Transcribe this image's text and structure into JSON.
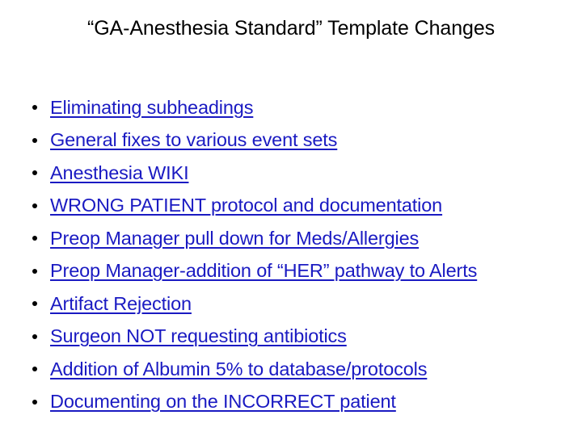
{
  "slide": {
    "title": "“GA-Anesthesia Standard” Template Changes",
    "background_color": "#ffffff",
    "title_color": "#000000",
    "bullet_marker_color": "#000000",
    "link_color": "#1a1ac2",
    "bullets": [
      {
        "label": "Eliminating subheadings"
      },
      {
        "label": "General fixes to various event sets"
      },
      {
        "label": "Anesthesia WIKI"
      },
      {
        "label": "WRONG PATIENT protocol and documentation"
      },
      {
        "label": "Preop Manager pull down for Meds/Allergies"
      },
      {
        "label": "Preop Manager-addition of “HER” pathway to Alerts"
      },
      {
        "label": "Artifact Rejection"
      },
      {
        "label": "Surgeon NOT requesting antibiotics"
      },
      {
        "label": "Addition of Albumin 5% to database/protocols"
      },
      {
        "label": "Documenting on the INCORRECT patient"
      }
    ]
  }
}
